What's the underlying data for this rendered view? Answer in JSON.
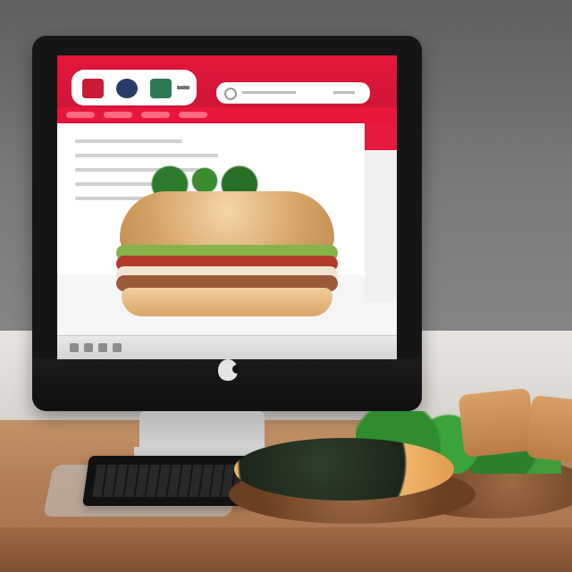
{
  "scene": {
    "description_tags": [
      "monitor",
      "burger-photo",
      "keyboard",
      "plates",
      "food"
    ],
    "colors": {
      "accent_red": "#e3163b",
      "screen_bg": "#f5f5f5"
    }
  },
  "icons": {
    "logo": "apple-logo-icon",
    "search": "search-icon"
  }
}
